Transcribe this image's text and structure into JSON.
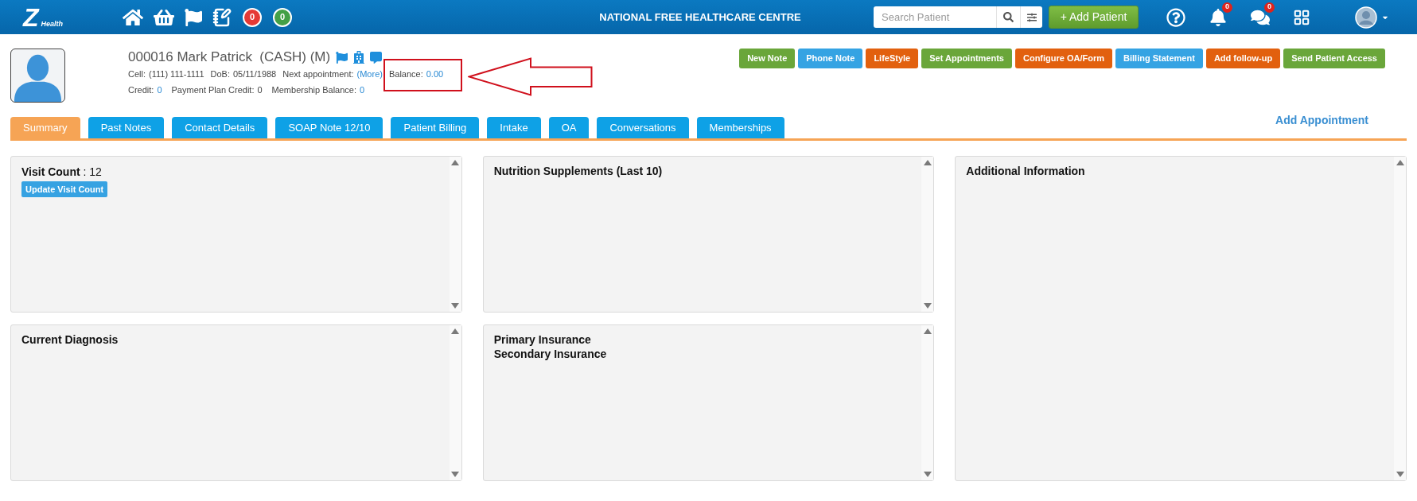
{
  "top_bar": {
    "logo": {
      "mark": "Z",
      "text": "Health"
    },
    "badges": [
      {
        "count": "0",
        "color": "#e53935"
      },
      {
        "count": "0",
        "color": "#43a047"
      }
    ],
    "title": "NATIONAL FREE HEALTHCARE CENTRE",
    "search": {
      "placeholder": "Search Patient"
    },
    "add_button": "+ Add Patient",
    "notifications": {
      "count": "0"
    },
    "messages": {
      "count": "0"
    }
  },
  "patient": {
    "name": "000016 Mark Patrick  (CASH) (M)",
    "info_lines": [
      [
        {
          "label": "Cell:",
          "value": "(111) 111-1111",
          "link": false,
          "highlighted": false
        },
        {
          "label": "DoB:",
          "value": "05/11/1988",
          "link": false,
          "highlighted": false
        },
        {
          "label": "Next appointment:",
          "value": "(More)",
          "link": true,
          "highlighted": false
        },
        {
          "label": "Balance:",
          "value": "0.00",
          "link": true,
          "highlighted": true
        }
      ],
      [
        {
          "label": "Credit:",
          "value": "0",
          "link": true,
          "highlighted": false
        },
        {
          "label": "Payment Plan Credit:",
          "value": "0",
          "link": false,
          "highlighted": false
        },
        {
          "label": "Membership Balance:",
          "value": "0",
          "link": true,
          "highlighted": false
        }
      ]
    ]
  },
  "actions": [
    {
      "label": "New Note",
      "color": "#6aa63a"
    },
    {
      "label": "Phone Note",
      "color": "#35a3e3"
    },
    {
      "label": "LifeStyle",
      "color": "#e2600e"
    },
    {
      "label": "Set Appointments",
      "color": "#6aa63a"
    },
    {
      "label": "Configure OA/Form",
      "color": "#e2600e"
    },
    {
      "label": "Billing Statement",
      "color": "#35a3e3"
    },
    {
      "label": "Add follow-up",
      "color": "#e2600e"
    },
    {
      "label": "Send Patient Access",
      "color": "#6aa63a"
    }
  ],
  "tabs": [
    {
      "label": "Summary",
      "selected": true
    },
    {
      "label": "Past Notes",
      "selected": false
    },
    {
      "label": "Contact Details",
      "selected": false
    },
    {
      "label": "SOAP Note 12/10",
      "selected": false
    },
    {
      "label": "Patient Billing",
      "selected": false
    },
    {
      "label": "Intake",
      "selected": false
    },
    {
      "label": "OA",
      "selected": false
    },
    {
      "label": "Conversations",
      "selected": false
    },
    {
      "label": "Memberships",
      "selected": false
    }
  ],
  "add_appointment": "Add Appointment",
  "panel_columns": [
    [
      {
        "kind": "counter",
        "text": "**Visit Count** : 12",
        "button": "Update Visit Count"
      },
      {
        "kind": "headings",
        "headings": [
          "Current Diagnosis"
        ]
      }
    ],
    [
      {
        "kind": "headings",
        "headings": [
          "Nutrition Supplements (Last 10)"
        ]
      },
      {
        "kind": "headings",
        "headings": [
          "Primary Insurance",
          "Secondary Insurance"
        ]
      }
    ],
    [
      {
        "kind": "headings",
        "headings": [
          "Additional Information"
        ]
      }
    ]
  ]
}
